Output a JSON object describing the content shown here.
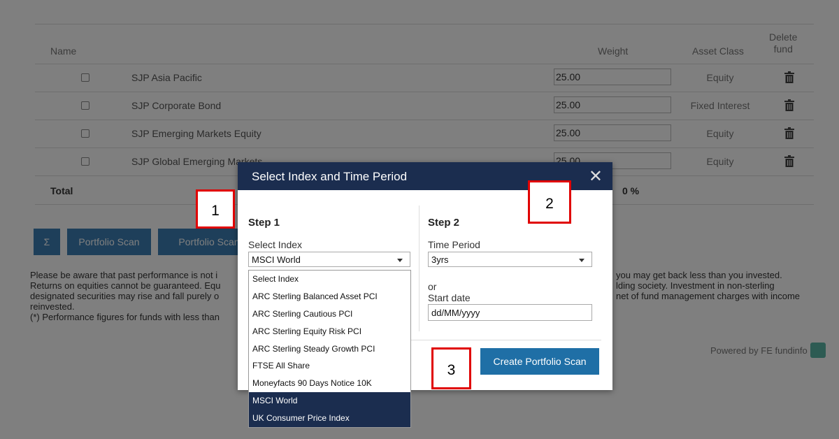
{
  "table": {
    "headers": {
      "name": "Name",
      "weight": "Weight",
      "asset_class": "Asset Class",
      "delete_line1": "Delete",
      "delete_line2": "fund"
    },
    "rows": [
      {
        "name": "SJP Asia Pacific",
        "weight": "25.00",
        "asset_class": "Equity"
      },
      {
        "name": "SJP Corporate Bond",
        "weight": "25.00",
        "asset_class": "Fixed Interest"
      },
      {
        "name": "SJP Emerging Markets Equity",
        "weight": "25.00",
        "asset_class": "Equity"
      },
      {
        "name": "SJP Global Emerging Markets",
        "weight": "25.00",
        "asset_class": "Equity"
      }
    ],
    "total_label": "Total",
    "total_value": "0 %"
  },
  "buttons": {
    "sigma": "Σ",
    "portfolio_scan": "Portfolio Scan",
    "portfolio_scan_r": "Portfolio Scan R"
  },
  "disclaimer": {
    "line1_left": "Please be aware that past performance is not i",
    "line1_right": "you may get back less than you invested.",
    "line2_left": "Returns on equities cannot be guaranteed. Equ",
    "line2_right": "lding society. Investment in non-sterling",
    "line3_left": "designated securities may rise and fall purely o",
    "line3_right": "net of fund management charges with income",
    "line4": "reinvested.",
    "line5": "(*) Performance figures for funds with less than"
  },
  "powered_by": "Powered by FE fundinfo",
  "modal": {
    "title": "Select Index and Time Period",
    "close": "✕",
    "step1": "Step 1",
    "select_index_label": "Select Index",
    "select_index_value": "MSCI World",
    "step2": "Step 2",
    "time_period_label": "Time Period",
    "time_period_value": "3yrs",
    "or": "or",
    "start_date_label": "Start date",
    "start_date_placeholder": "dd/MM/yyyy",
    "create_button": "Create Portfolio Scan"
  },
  "index_options": [
    "Select Index",
    "ARC Sterling Balanced Asset PCI",
    "ARC Sterling Cautious PCI",
    "ARC Sterling Equity Risk PCI",
    "ARC Sterling Steady Growth PCI",
    "FTSE All Share",
    "Moneyfacts 90 Days Notice 10K",
    "MSCI World",
    "UK Consumer Price Index"
  ],
  "annotations": {
    "a1": "1",
    "a2": "2",
    "a3": "3"
  }
}
